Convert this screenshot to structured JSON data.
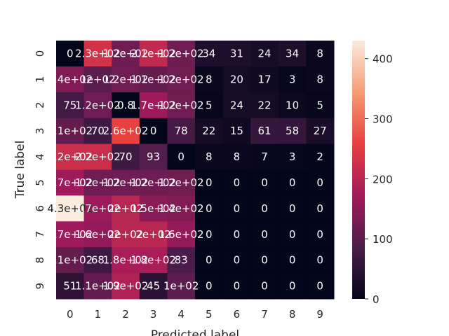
{
  "chart_data": {
    "type": "heatmap",
    "title": "",
    "xlabel": "Predicted label",
    "ylabel": "True label",
    "x_categories": [
      "0",
      "1",
      "2",
      "3",
      "4",
      "5",
      "6",
      "7",
      "8",
      "9"
    ],
    "y_categories": [
      "0",
      "1",
      "2",
      "3",
      "4",
      "5",
      "6",
      "7",
      "8",
      "9"
    ],
    "values": [
      [
        0,
        230,
        120,
        210,
        120,
        34,
        31,
        24,
        34,
        8
      ],
      [
        140,
        100,
        120,
        110,
        120,
        8,
        20,
        17,
        3,
        8
      ],
      [
        75,
        120,
        0.8,
        170,
        120,
        5,
        24,
        22,
        10,
        5
      ],
      [
        110,
        70,
        260,
        0,
        78,
        22,
        15,
        61,
        58,
        27
      ],
      [
        220,
        220,
        70,
        93,
        0,
        8,
        8,
        7,
        3,
        2
      ],
      [
        170,
        120,
        120,
        120,
        120,
        0,
        0,
        0,
        0,
        0
      ],
      [
        430,
        170,
        200,
        150,
        140,
        0,
        0,
        0,
        0,
        0
      ],
      [
        170,
        160,
        200,
        200,
        160,
        0,
        0,
        0,
        0,
        0
      ],
      [
        110,
        68,
        180,
        180,
        83,
        0,
        0,
        0,
        0,
        0
      ],
      [
        51,
        110,
        190,
        45,
        100,
        0,
        0,
        0,
        0,
        0
      ]
    ],
    "annotations": [
      [
        "0",
        "2.3e+02",
        "1.2e+02",
        "2.1e+02",
        "1.2e+02",
        "34",
        "31",
        "24",
        "34",
        "8"
      ],
      [
        "1.4e+02",
        "1e+02",
        "1.2e+02",
        "1.1e+02",
        "1.2e+02",
        "8",
        "20",
        "17",
        "3",
        "8"
      ],
      [
        "75",
        "1.2e+02",
        "0.8",
        "1.7e+02",
        "1.2e+02",
        "5",
        "24",
        "22",
        "10",
        "5"
      ],
      [
        "1.1e+02",
        "70",
        "2.6e+02",
        "0",
        "78",
        "22",
        "15",
        "61",
        "58",
        "27"
      ],
      [
        "2.2e+02",
        "2.2e+02",
        "70",
        "93",
        "0",
        "8",
        "8",
        "7",
        "3",
        "2"
      ],
      [
        "1.7e+02",
        "1.2e+02",
        "1.2e+02",
        "1.2e+02",
        "1.2e+02",
        "0",
        "0",
        "0",
        "0",
        "0"
      ],
      [
        "4.3e+02",
        "1.7e+02",
        "2e+02",
        "1.5e+02",
        "1.4e+02",
        "0",
        "0",
        "0",
        "0",
        "0"
      ],
      [
        "1.7e+02",
        "1.6e+02",
        "2e+02",
        "2e+02",
        "1.6e+02",
        "0",
        "0",
        "0",
        "0",
        "0"
      ],
      [
        "1.1e+02",
        "68",
        "1.8e+02",
        "1.8e+02",
        "83",
        "0",
        "0",
        "0",
        "0",
        "0"
      ],
      [
        "51",
        "1.1e+02",
        "1.9e+02",
        "45",
        "1e+02",
        "0",
        "0",
        "0",
        "0",
        "0"
      ]
    ],
    "colorbar": {
      "min": 0,
      "max": 430,
      "ticks": [
        0,
        100,
        200,
        300,
        400
      ],
      "colormap": "rocket",
      "colors": [
        "#03051a",
        "#4c1d4b",
        "#a11a5b",
        "#e83f3f",
        "#f69c73",
        "#faebdd"
      ]
    },
    "text_colors": {
      "light": "#ffffff",
      "dark": "#262626"
    }
  }
}
